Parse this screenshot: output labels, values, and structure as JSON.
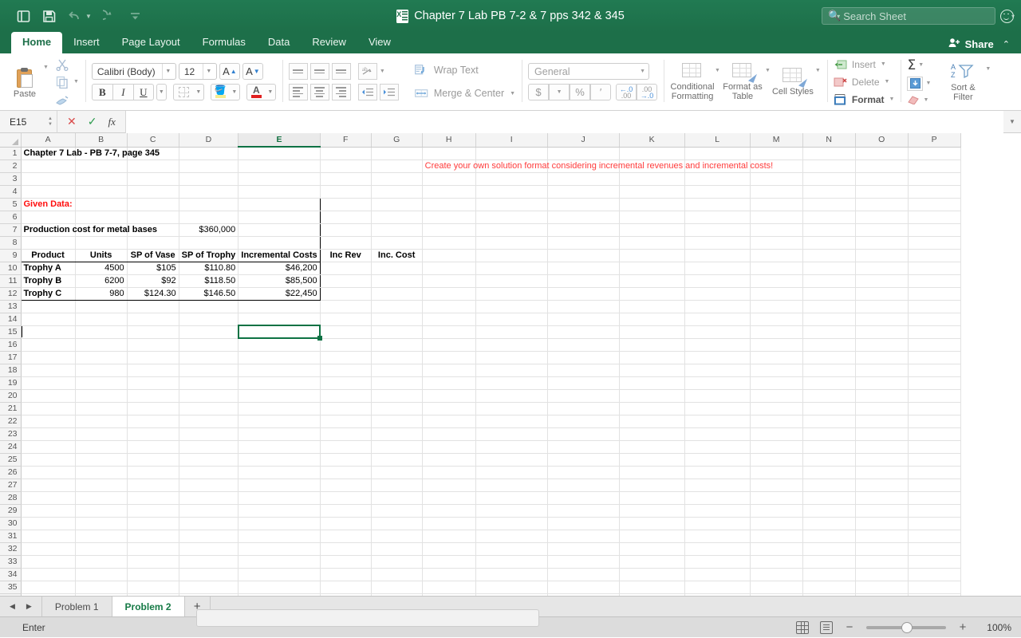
{
  "titlebar": {
    "document_title": "Chapter 7 Lab PB 7-2 & 7 pps 342 & 345",
    "quick_access": [
      "sidebar-toggle",
      "save",
      "undo",
      "redo",
      "customize"
    ],
    "search_placeholder": "Search Sheet"
  },
  "ribbon": {
    "tabs": [
      {
        "label": "Home",
        "active": true
      },
      {
        "label": "Insert",
        "active": false
      },
      {
        "label": "Page Layout",
        "active": false
      },
      {
        "label": "Formulas",
        "active": false
      },
      {
        "label": "Data",
        "active": false
      },
      {
        "label": "Review",
        "active": false
      },
      {
        "label": "View",
        "active": false
      }
    ],
    "share_label": "Share",
    "clipboard": {
      "paste_label": "Paste",
      "cut": "cut-icon",
      "copy": "copy-icon",
      "format_painter": "format-painter-icon"
    },
    "font": {
      "family": "Calibri (Body)",
      "size": "12",
      "grow_label": "A",
      "shrink_label": "A",
      "bold": "B",
      "italic": "I",
      "underline": "U",
      "fill_color": "#f4ec90",
      "font_color": "#e02020"
    },
    "alignment": {
      "wrap_text": "Wrap Text",
      "merge_center": "Merge & Center"
    },
    "number": {
      "format": "General",
      "currency": "$",
      "percent": "%",
      "comma": "′",
      "increase_decimal": ".00",
      "decrease_decimal": ".00"
    },
    "styles": {
      "conditional_formatting": "Conditional Formatting",
      "format_as_table": "Format as Table",
      "cell_styles": "Cell Styles"
    },
    "cells": {
      "insert": "Insert",
      "delete": "Delete",
      "format": "Format"
    },
    "editing": {
      "autosum": "Σ",
      "fill": "fill-icon",
      "clear": "clear-icon",
      "sort_filter": "Sort & Filter"
    }
  },
  "formula_bar": {
    "name_box": "E15",
    "cancel_icon": "cancel-icon",
    "confirm_icon": "confirm-icon",
    "function_icon": "fx",
    "formula_value": ""
  },
  "grid": {
    "columns": [
      "A",
      "B",
      "C",
      "D",
      "E",
      "F",
      "G",
      "H",
      "I",
      "J",
      "K",
      "L",
      "M",
      "N",
      "O",
      "P"
    ],
    "selected_column": "E",
    "selected_cell": "E15",
    "row_count": 36,
    "cells": {
      "A1": "Chapter 7 Lab - PB 7-7, page 345",
      "H2": "Create your own solution format considering incremental revenues and incremental costs!",
      "A5": "Given Data:",
      "A7": "Production cost for metal bases",
      "D7": "$360,000",
      "A9": "Product",
      "B9": "Units",
      "C9": "SP of Vase",
      "D9": "SP of Trophy",
      "E9": "Incremental Costs",
      "F9": "Inc Rev",
      "G9": "Inc. Cost",
      "A10": "Trophy A",
      "B10": "4500",
      "C10": "$105",
      "D10": "$110.80",
      "E10": "$46,200",
      "A11": "Trophy B",
      "B11": "6200",
      "C11": "$92",
      "D11": "$118.50",
      "E11": "$85,500",
      "A12": "Trophy C",
      "B12": "980",
      "C12": "$124.30",
      "D12": "$146.50",
      "E12": "$22,450"
    }
  },
  "sheet_tabs": {
    "prev_icon": "prev-sheet-icon",
    "next_icon": "next-sheet-icon",
    "tabs": [
      {
        "label": "Problem 1",
        "active": false
      },
      {
        "label": "Problem 2",
        "active": true
      }
    ],
    "add_label": "+"
  },
  "status_bar": {
    "mode": "Enter",
    "normal_view_icon": "normal-view-icon",
    "page_layout_icon": "page-layout-icon",
    "zoom_out": "−",
    "zoom_in": "+",
    "zoom_level": "100%"
  }
}
